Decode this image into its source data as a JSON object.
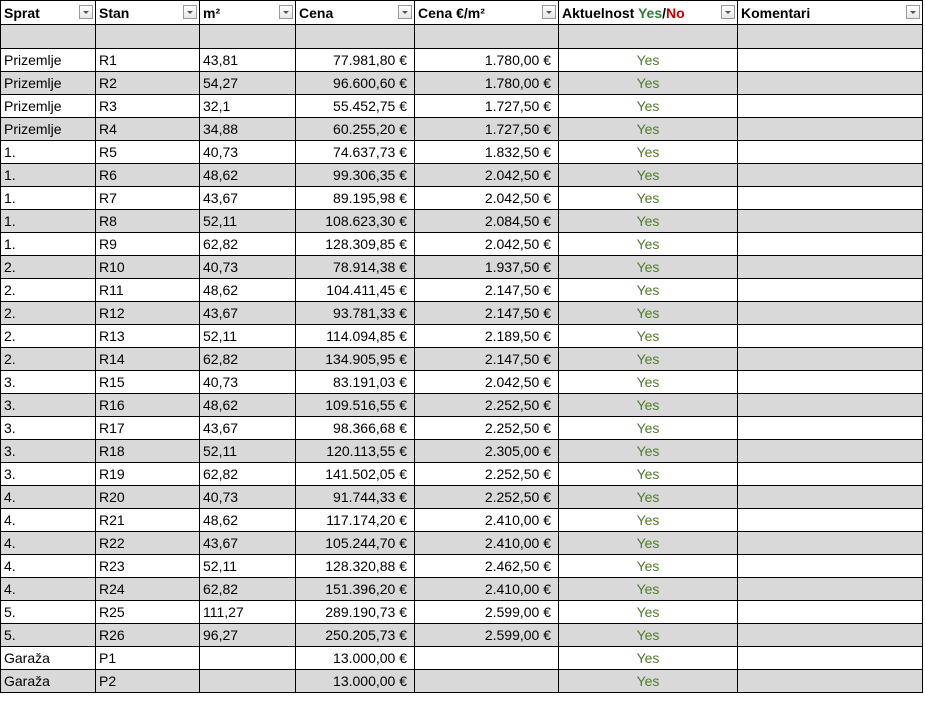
{
  "headers": {
    "sprat": "Sprat",
    "stan": "Stan",
    "m2": "m²",
    "cena": "Cena",
    "cena_m2": "Cena €/m²",
    "aktuelnost": "Aktuelnost",
    "aktuelnost_yes": "Yes",
    "aktuelnost_sep": "/",
    "aktuelnost_no": "No",
    "komentari": "Komentari"
  },
  "colors": {
    "yes": "#4f7d2a",
    "no": "#c00000",
    "row_alt": "#d9d9d9"
  },
  "rows": [
    {
      "sprat": "Prizemlje",
      "stan": "R1",
      "m2": "43,81",
      "cena": "77.981,80 €",
      "cena_m2": "1.780,00 €",
      "status": "Yes",
      "komentar": ""
    },
    {
      "sprat": "Prizemlje",
      "stan": "R2",
      "m2": "54,27",
      "cena": "96.600,60 €",
      "cena_m2": "1.780,00 €",
      "status": "Yes",
      "komentar": ""
    },
    {
      "sprat": "Prizemlje",
      "stan": "R3",
      "m2": "32,1",
      "cena": "55.452,75 €",
      "cena_m2": "1.727,50 €",
      "status": "Yes",
      "komentar": ""
    },
    {
      "sprat": "Prizemlje",
      "stan": "R4",
      "m2": "34,88",
      "cena": "60.255,20 €",
      "cena_m2": "1.727,50 €",
      "status": "Yes",
      "komentar": ""
    },
    {
      "sprat": "1.",
      "stan": "R5",
      "m2": "40,73",
      "cena": "74.637,73 €",
      "cena_m2": "1.832,50 €",
      "status": "Yes",
      "komentar": ""
    },
    {
      "sprat": "1.",
      "stan": "R6",
      "m2": "48,62",
      "cena": "99.306,35 €",
      "cena_m2": "2.042,50 €",
      "status": "Yes",
      "komentar": ""
    },
    {
      "sprat": "1.",
      "stan": "R7",
      "m2": "43,67",
      "cena": "89.195,98 €",
      "cena_m2": "2.042,50 €",
      "status": "Yes",
      "komentar": ""
    },
    {
      "sprat": "1.",
      "stan": "R8",
      "m2": "52,11",
      "cena": "108.623,30 €",
      "cena_m2": "2.084,50 €",
      "status": "Yes",
      "komentar": ""
    },
    {
      "sprat": "1.",
      "stan": "R9",
      "m2": "62,82",
      "cena": "128.309,85 €",
      "cena_m2": "2.042,50 €",
      "status": "Yes",
      "komentar": ""
    },
    {
      "sprat": "2.",
      "stan": "R10",
      "m2": "40,73",
      "cena": "78.914,38 €",
      "cena_m2": "1.937,50 €",
      "status": "Yes",
      "komentar": ""
    },
    {
      "sprat": "2.",
      "stan": "R11",
      "m2": "48,62",
      "cena": "104.411,45 €",
      "cena_m2": "2.147,50 €",
      "status": "Yes",
      "komentar": ""
    },
    {
      "sprat": "2.",
      "stan": "R12",
      "m2": "43,67",
      "cena": "93.781,33 €",
      "cena_m2": "2.147,50 €",
      "status": "Yes",
      "komentar": ""
    },
    {
      "sprat": "2.",
      "stan": "R13",
      "m2": "52,11",
      "cena": "114.094,85 €",
      "cena_m2": "2.189,50 €",
      "status": "Yes",
      "komentar": ""
    },
    {
      "sprat": "2.",
      "stan": "R14",
      "m2": "62,82",
      "cena": "134.905,95 €",
      "cena_m2": "2.147,50 €",
      "status": "Yes",
      "komentar": ""
    },
    {
      "sprat": "3.",
      "stan": "R15",
      "m2": "40,73",
      "cena": "83.191,03 €",
      "cena_m2": "2.042,50 €",
      "status": "Yes",
      "komentar": ""
    },
    {
      "sprat": "3.",
      "stan": "R16",
      "m2": "48,62",
      "cena": "109.516,55 €",
      "cena_m2": "2.252,50 €",
      "status": "Yes",
      "komentar": ""
    },
    {
      "sprat": "3.",
      "stan": "R17",
      "m2": "43,67",
      "cena": "98.366,68 €",
      "cena_m2": "2.252,50 €",
      "status": "Yes",
      "komentar": ""
    },
    {
      "sprat": "3.",
      "stan": "R18",
      "m2": "52,11",
      "cena": "120.113,55 €",
      "cena_m2": "2.305,00 €",
      "status": "Yes",
      "komentar": ""
    },
    {
      "sprat": "3.",
      "stan": "R19",
      "m2": "62,82",
      "cena": "141.502,05 €",
      "cena_m2": "2.252,50 €",
      "status": "Yes",
      "komentar": ""
    },
    {
      "sprat": "4.",
      "stan": "R20",
      "m2": "40,73",
      "cena": "91.744,33 €",
      "cena_m2": "2.252,50 €",
      "status": "Yes",
      "komentar": ""
    },
    {
      "sprat": "4.",
      "stan": "R21",
      "m2": "48,62",
      "cena": "117.174,20 €",
      "cena_m2": "2.410,00 €",
      "status": "Yes",
      "komentar": ""
    },
    {
      "sprat": "4.",
      "stan": "R22",
      "m2": "43,67",
      "cena": "105.244,70 €",
      "cena_m2": "2.410,00 €",
      "status": "Yes",
      "komentar": ""
    },
    {
      "sprat": "4.",
      "stan": "R23",
      "m2": "52,11",
      "cena": "128.320,88 €",
      "cena_m2": "2.462,50 €",
      "status": "Yes",
      "komentar": ""
    },
    {
      "sprat": "4.",
      "stan": "R24",
      "m2": "62,82",
      "cena": "151.396,20 €",
      "cena_m2": "2.410,00 €",
      "status": "Yes",
      "komentar": ""
    },
    {
      "sprat": "5.",
      "stan": "R25",
      "m2": "111,27",
      "cena": "289.190,73 €",
      "cena_m2": "2.599,00 €",
      "status": "Yes",
      "komentar": ""
    },
    {
      "sprat": "5.",
      "stan": "R26",
      "m2": "96,27",
      "cena": "250.205,73 €",
      "cena_m2": "2.599,00 €",
      "status": "Yes",
      "komentar": ""
    },
    {
      "sprat": "Garaža",
      "stan": "P1",
      "m2": "",
      "cena": "13.000,00 €",
      "cena_m2": "",
      "status": "Yes",
      "komentar": ""
    },
    {
      "sprat": "Garaža",
      "stan": "P2",
      "m2": "",
      "cena": "13.000,00 €",
      "cena_m2": "",
      "status": "Yes",
      "komentar": ""
    }
  ]
}
